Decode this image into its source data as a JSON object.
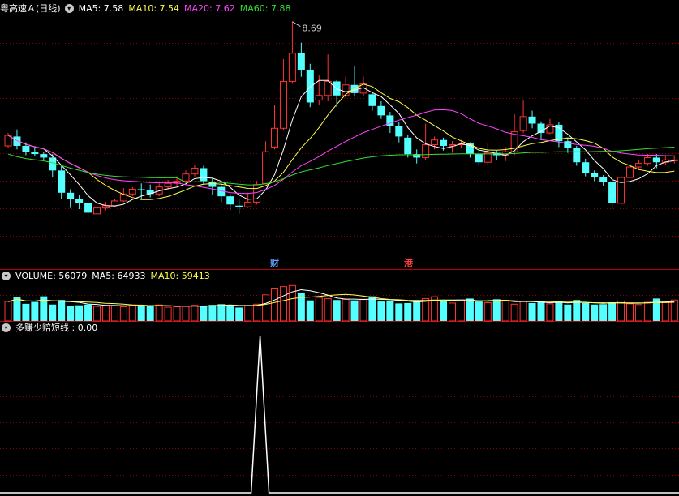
{
  "main": {
    "title": "粤高速Ａ(日线)",
    "ma": [
      {
        "label": "MA5: 7.58",
        "color": "#ffffff"
      },
      {
        "label": "MA10: 7.54",
        "color": "#ffff4c"
      },
      {
        "label": "MA20: 7.62",
        "color": "#ff44ff"
      },
      {
        "label": "MA60: 7.88",
        "color": "#33dd33"
      }
    ],
    "peak_label": "8.69",
    "events": [
      {
        "label": "财",
        "color": "#5aa0ff",
        "index": 26
      },
      {
        "label": "港",
        "color": "#ff4040",
        "index": 41
      }
    ]
  },
  "volume": {
    "title": "VOLUME: 56079",
    "ma": [
      {
        "label": "MA5: 64933",
        "color": "#ffffff"
      },
      {
        "label": "MA10: 59413",
        "color": "#ffff4c"
      }
    ]
  },
  "indicator": {
    "title": "多赚少赔短线 : 0.00"
  },
  "colors": {
    "up": "#ff3232",
    "down": "#54ffff",
    "ma5": "#ffffff",
    "ma10": "#ffff4c",
    "ma20": "#ff44ff",
    "ma60": "#33dd33",
    "grid": "#8a0000"
  },
  "chart_data": [
    {
      "type": "candlestick",
      "ma_periods": [
        5,
        10,
        20,
        60
      ],
      "ylim": [
        6.8,
        8.75
      ],
      "candles": [
        [
          7.63,
          7.72,
          7.74,
          7.61
        ],
        [
          7.71,
          7.63,
          7.77,
          7.6
        ],
        [
          7.63,
          7.58,
          7.66,
          7.55
        ],
        [
          7.58,
          7.56,
          7.62,
          7.54
        ],
        [
          7.56,
          7.53,
          7.58,
          7.5
        ],
        [
          7.53,
          7.42,
          7.56,
          7.36
        ],
        [
          7.42,
          7.23,
          7.46,
          7.18
        ],
        [
          7.23,
          7.18,
          7.26,
          7.1
        ],
        [
          7.18,
          7.14,
          7.21,
          7.09
        ],
        [
          7.14,
          7.06,
          7.17,
          7.01
        ],
        [
          7.05,
          7.1,
          7.13,
          7.04
        ],
        [
          7.1,
          7.12,
          7.15,
          7.08
        ],
        [
          7.12,
          7.16,
          7.18,
          7.11
        ],
        [
          7.16,
          7.22,
          7.27,
          7.15
        ],
        [
          7.22,
          7.26,
          7.28,
          7.2
        ],
        [
          7.26,
          7.25,
          7.31,
          7.18
        ],
        [
          7.25,
          7.22,
          7.3,
          7.19
        ],
        [
          7.22,
          7.28,
          7.31,
          7.2
        ],
        [
          7.28,
          7.31,
          7.34,
          7.26
        ],
        [
          7.31,
          7.33,
          7.37,
          7.29
        ],
        [
          7.33,
          7.39,
          7.42,
          7.31
        ],
        [
          7.39,
          7.44,
          7.47,
          7.37
        ],
        [
          7.44,
          7.33,
          7.46,
          7.3
        ],
        [
          7.32,
          7.28,
          7.35,
          7.21
        ],
        [
          7.28,
          7.2,
          7.31,
          7.15
        ],
        [
          7.2,
          7.13,
          7.22,
          7.08
        ],
        [
          7.12,
          7.11,
          7.18,
          7.05
        ],
        [
          7.11,
          7.15,
          7.23,
          7.1
        ],
        [
          7.15,
          7.3,
          7.33,
          7.13
        ],
        [
          7.31,
          7.58,
          7.67,
          7.31
        ],
        [
          7.62,
          7.78,
          7.98,
          7.6
        ],
        [
          7.78,
          8.18,
          8.37,
          7.76
        ],
        [
          8.18,
          8.42,
          8.69,
          8.16
        ],
        [
          8.42,
          8.28,
          8.51,
          8.22
        ],
        [
          8.28,
          8.0,
          8.33,
          7.96
        ],
        [
          8.02,
          8.06,
          8.23,
          7.98
        ],
        [
          8.06,
          8.18,
          8.41,
          8.01
        ],
        [
          8.18,
          8.06,
          8.19,
          7.96
        ],
        [
          8.06,
          8.15,
          8.22,
          8.04
        ],
        [
          8.15,
          8.08,
          8.31,
          8.05
        ],
        [
          8.08,
          8.16,
          8.22,
          8.06
        ],
        [
          8.07,
          7.97,
          8.09,
          7.93
        ],
        [
          7.97,
          7.89,
          8.01,
          7.86
        ],
        [
          7.89,
          7.8,
          7.92,
          7.74
        ],
        [
          7.8,
          7.71,
          7.83,
          7.66
        ],
        [
          7.7,
          7.56,
          7.72,
          7.53
        ],
        [
          7.56,
          7.53,
          7.6,
          7.48
        ],
        [
          7.53,
          7.64,
          7.82,
          7.51
        ],
        [
          7.64,
          7.68,
          7.71,
          7.6
        ],
        [
          7.68,
          7.63,
          7.7,
          7.59
        ],
        [
          7.63,
          7.64,
          7.67,
          7.57
        ],
        [
          7.64,
          7.65,
          7.68,
          7.61
        ],
        [
          7.65,
          7.56,
          7.66,
          7.53
        ],
        [
          7.56,
          7.49,
          7.62,
          7.46
        ],
        [
          7.49,
          7.57,
          7.65,
          7.47
        ],
        [
          7.57,
          7.55,
          7.59,
          7.51
        ],
        [
          7.55,
          7.58,
          7.62,
          7.5
        ],
        [
          7.58,
          7.75,
          7.9,
          7.55
        ],
        [
          7.76,
          7.88,
          8.02,
          7.74
        ],
        [
          7.88,
          7.82,
          7.93,
          7.78
        ],
        [
          7.82,
          7.74,
          7.84,
          7.69
        ],
        [
          7.74,
          7.81,
          7.86,
          7.73
        ],
        [
          7.81,
          7.67,
          7.83,
          7.62
        ],
        [
          7.67,
          7.61,
          7.7,
          7.57
        ],
        [
          7.61,
          7.49,
          7.63,
          7.46
        ],
        [
          7.49,
          7.4,
          7.52,
          7.37
        ],
        [
          7.4,
          7.36,
          7.42,
          7.33
        ],
        [
          7.36,
          7.32,
          7.38,
          7.29
        ],
        [
          7.32,
          7.14,
          7.35,
          7.09
        ],
        [
          7.14,
          7.36,
          7.42,
          7.12
        ],
        [
          7.36,
          7.45,
          7.48,
          7.34
        ],
        [
          7.45,
          7.48,
          7.51,
          7.43
        ],
        [
          7.48,
          7.53,
          7.56,
          7.46
        ],
        [
          7.53,
          7.49,
          7.56,
          7.44
        ],
        [
          7.49,
          7.51,
          7.54,
          7.47
        ],
        [
          7.51,
          7.51,
          7.55,
          7.48
        ]
      ]
    },
    {
      "type": "bar",
      "series_name": "VOLUME",
      "ylim": [
        0,
        160000
      ],
      "values": [
        52,
        64,
        46,
        51,
        66,
        44,
        56,
        41,
        42,
        44,
        39,
        42,
        41,
        38,
        43,
        40,
        41,
        43,
        37,
        38,
        39,
        42,
        41,
        43,
        45,
        43,
        36,
        41,
        45,
        70,
        88,
        92,
        95,
        74,
        55,
        63,
        60,
        56,
        58,
        55,
        58,
        66,
        52,
        53,
        47,
        48,
        54,
        60,
        65,
        53,
        48,
        55,
        60,
        52,
        49,
        58,
        55,
        45,
        53,
        48,
        52,
        46,
        52,
        44,
        56,
        48,
        44,
        45,
        50,
        53,
        46,
        44,
        50,
        60,
        52,
        56
      ],
      "value_unit_multiplier": 1000
    },
    {
      "type": "line",
      "series_name": "多赚少赔短线",
      "ylim": [
        0,
        1
      ],
      "spike_index": 28,
      "spike_value": 1,
      "baseline": 0
    }
  ]
}
